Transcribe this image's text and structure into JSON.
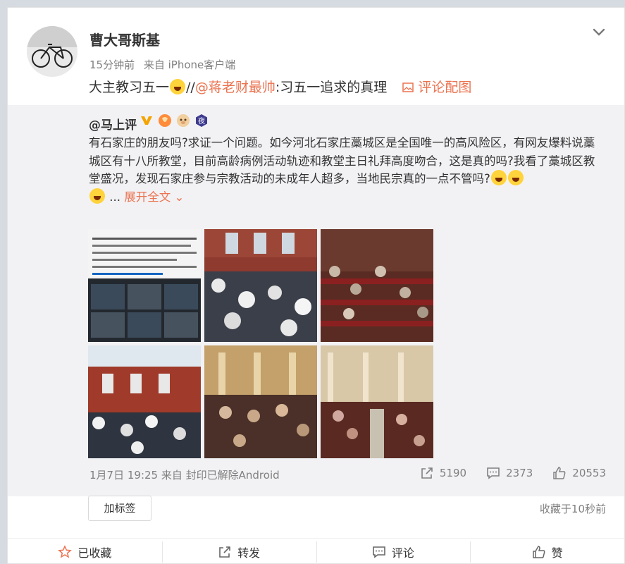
{
  "post": {
    "author": "曹大哥斯基",
    "time": "15分钟前",
    "source": "来自 iPhone客户端",
    "text_before": "大主教习五一",
    "text_mid": "//",
    "mention": "@蒋老财最帅",
    "text_after": ":习五一追求的真理",
    "comment_image_label": "评论配图"
  },
  "repost": {
    "author": "@马上评",
    "text": "有石家庄的朋友吗?求证一个问题。如今河北石家庄藁城区是全国唯一的高风险区，有网友爆料说藁城区有十八所教堂，目前高龄病例活动轨迹和教堂主日礼拜高度吻合，这是真的吗?我看了藁城区教堂盛况，发现石家庄参与宗教活动的未成年人超多，当地民宗真的一点不管吗?",
    "ellipsis": "...",
    "expand_label": "展开全文",
    "date": "1月7日 19:25",
    "source": "来自 封印已解除Android",
    "reposts": "5190",
    "comments": "2373",
    "likes": "20553"
  },
  "actions": {
    "tag_button": "加标签",
    "saved_time": "收藏于10秒前",
    "favorited": "已收藏",
    "repost": "转发",
    "comment": "评论",
    "like": "赞"
  },
  "colors": {
    "link": "#eb7350",
    "muted": "#808080",
    "repost_bg": "#f2f2f5"
  }
}
